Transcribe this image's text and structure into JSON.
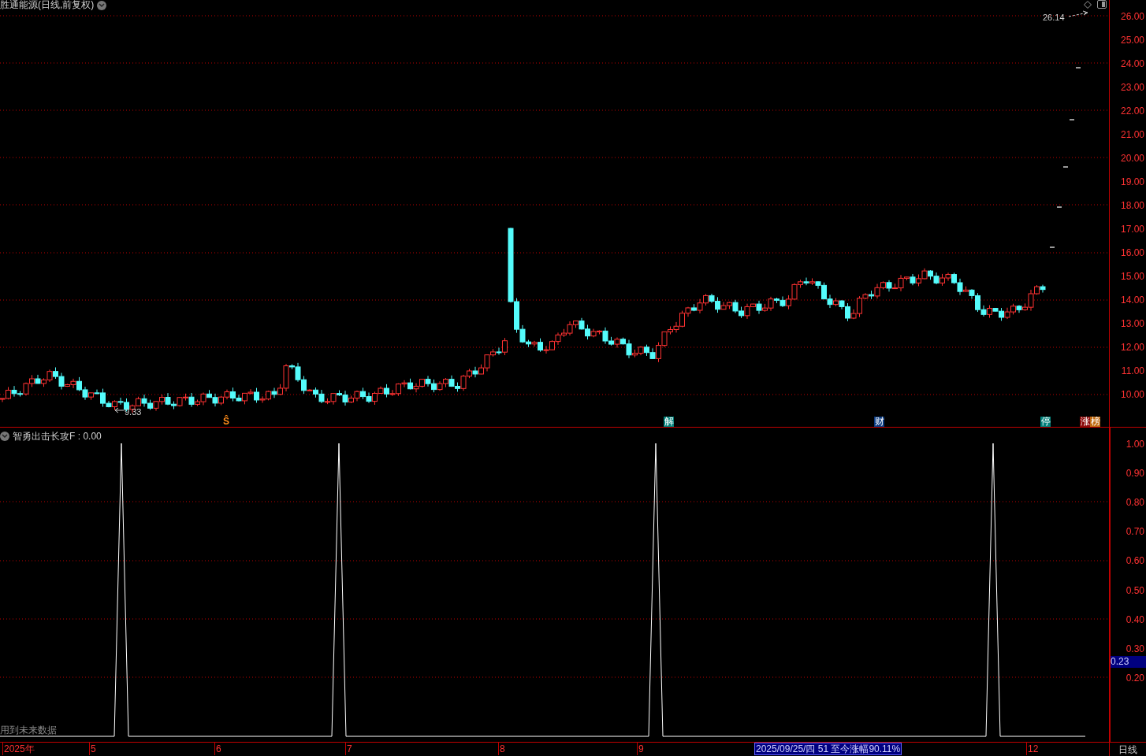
{
  "title": "胜通能源(日线,前复权)",
  "peak_reading": "26.14",
  "low_reading": "9.33",
  "price_axis": [
    "26.00",
    "25.00",
    "24.00",
    "23.00",
    "22.00",
    "21.00",
    "20.00",
    "19.00",
    "18.00",
    "17.00",
    "16.00",
    "15.00",
    "14.00",
    "13.00",
    "12.00",
    "11.00",
    "10.00"
  ],
  "event_markers": [
    {
      "label": "Ŝ",
      "kind": "text",
      "color": "#ff8c1a"
    },
    {
      "label": "解",
      "kind": "badge",
      "color": "#00807a"
    },
    {
      "label": "财",
      "kind": "badge",
      "color": "#0a3a80"
    },
    {
      "label": "停",
      "kind": "badge",
      "color": "#00807a"
    },
    {
      "label": "涨",
      "kind": "badge",
      "color": "#8b0a0a"
    },
    {
      "label": "榜",
      "kind": "badge",
      "color": "#c06a10"
    }
  ],
  "indicator": {
    "title": "智勇出击长攻F",
    "separator": ":",
    "value": "0.00",
    "axis": [
      "1.00",
      "0.90",
      "0.80",
      "0.70",
      "0.60",
      "0.50",
      "0.40",
      "0.30",
      "0.20"
    ],
    "current_value": "0.23"
  },
  "notice": "用到未来数据",
  "time_axis": [
    "2025年",
    "5",
    "6",
    "7",
    "8",
    "9",
    "12"
  ],
  "status": "2025/09/25/四 51 至今涨幅90.11%",
  "period": "日线"
}
